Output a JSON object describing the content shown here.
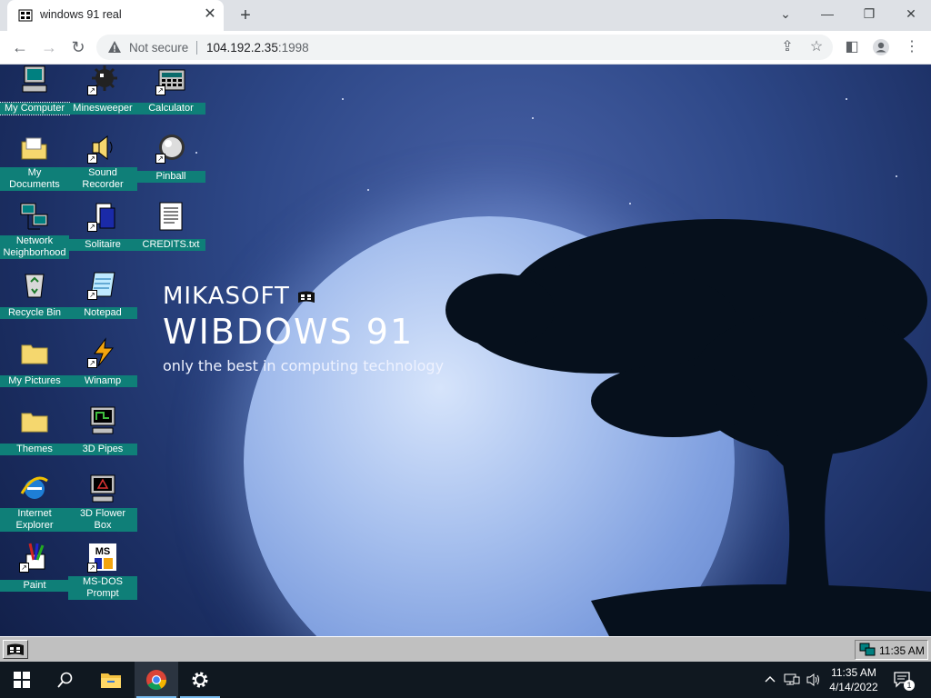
{
  "browser": {
    "tab_title": "windows 91 real",
    "security_label": "Not secure",
    "url_host": "104.192.2.35",
    "url_port": ":1998"
  },
  "desktop": {
    "brand_line1": "MIKASOFT",
    "brand_line2": "WIBDOWS 91",
    "brand_tagline": "only the best in computing technology",
    "icons": [
      {
        "label": "My Computer",
        "icon": "computer-icon"
      },
      {
        "label": "Minesweeper",
        "icon": "mine-icon"
      },
      {
        "label": "Calculator",
        "icon": "calculator-icon"
      },
      {
        "label": "My Documents",
        "icon": "folder-open-icon"
      },
      {
        "label": "Sound Recorder",
        "icon": "speaker-icon"
      },
      {
        "label": "Pinball",
        "icon": "pinball-icon"
      },
      {
        "label": "Network Neighborhood",
        "icon": "network-icon"
      },
      {
        "label": "Solitaire",
        "icon": "cards-icon"
      },
      {
        "label": "CREDITS.txt",
        "icon": "text-file-icon"
      },
      {
        "label": "Recycle Bin",
        "icon": "recycle-bin-icon"
      },
      {
        "label": "Notepad",
        "icon": "notepad-icon"
      },
      {
        "label": "My Pictures",
        "icon": "folder-icon"
      },
      {
        "label": "Winamp",
        "icon": "winamp-icon"
      },
      {
        "label": "Themes",
        "icon": "folder-icon"
      },
      {
        "label": "3D Pipes",
        "icon": "screensaver-icon"
      },
      {
        "label": "Internet Explorer",
        "icon": "internet-explorer-icon"
      },
      {
        "label": "3D Flower Box",
        "icon": "screensaver-icon"
      },
      {
        "label": "Paint",
        "icon": "paint-icon"
      },
      {
        "label": "MS-DOS Prompt",
        "icon": "msdos-icon"
      }
    ]
  },
  "win91_taskbar": {
    "clock": "11:35 AM"
  },
  "win10_taskbar": {
    "time": "11:35 AM",
    "date": "4/14/2022",
    "notification_count": "1"
  },
  "colors": {
    "icon_label_bg": "#0f7f78",
    "win91_gray": "#c0c0c0",
    "win10_taskbar": "#101820"
  }
}
